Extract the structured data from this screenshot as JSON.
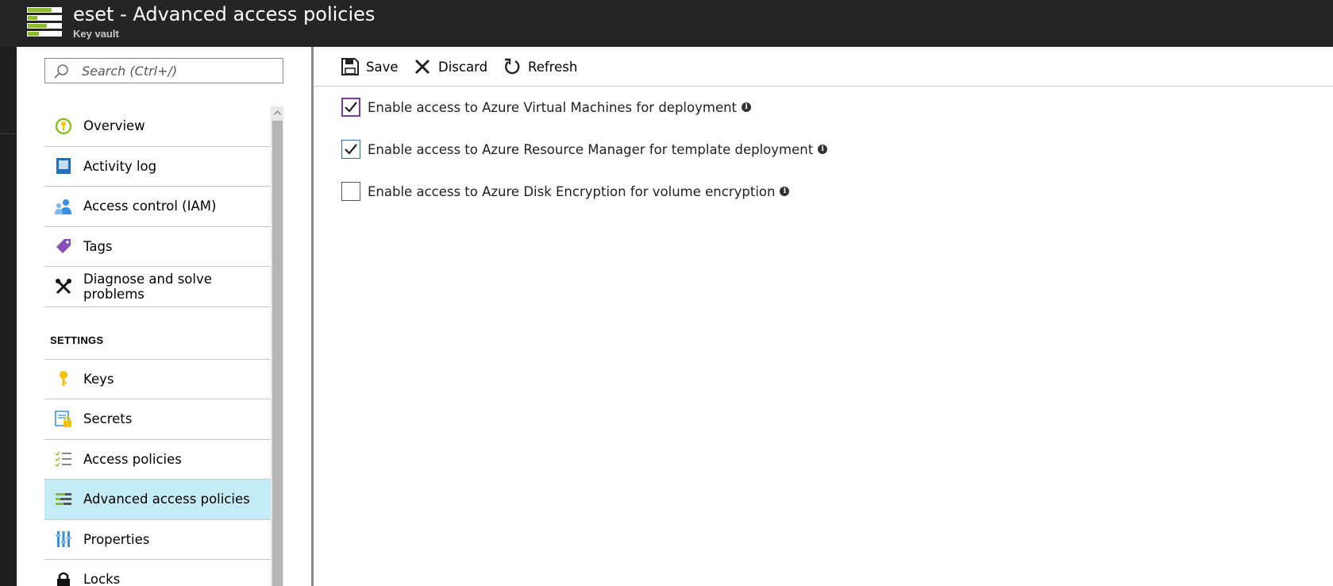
{
  "header": {
    "title": "eset - Advanced access policies",
    "subtitle": "Key vault",
    "icon": "key-vault-policies-icon"
  },
  "search": {
    "placeholder": "Search (Ctrl+/)",
    "value": ""
  },
  "sidebar": {
    "items": [
      {
        "label": "Overview",
        "icon": "overview-icon"
      },
      {
        "label": "Activity log",
        "icon": "activity-log-icon"
      },
      {
        "label": "Access control (IAM)",
        "icon": "iam-icon"
      },
      {
        "label": "Tags",
        "icon": "tag-icon"
      },
      {
        "label": "Diagnose and solve problems",
        "icon": "wrench-icon"
      }
    ],
    "section_label": "SETTINGS",
    "settings_items": [
      {
        "label": "Keys",
        "icon": "key-icon"
      },
      {
        "label": "Secrets",
        "icon": "secrets-icon"
      },
      {
        "label": "Access policies",
        "icon": "access-policies-icon"
      },
      {
        "label": "Advanced access policies",
        "icon": "advanced-policies-icon",
        "active": true
      },
      {
        "label": "Properties",
        "icon": "properties-icon"
      },
      {
        "label": "Locks",
        "icon": "lock-icon"
      }
    ]
  },
  "toolbar": {
    "save_label": "Save",
    "discard_label": "Discard",
    "refresh_label": "Refresh"
  },
  "options": [
    {
      "label": "Enable access to Azure Virtual Machines for deployment",
      "checked": true
    },
    {
      "label": "Enable access to Azure Resource Manager for template deployment",
      "checked": true
    },
    {
      "label": "Enable access to Azure Disk Encryption for volume encryption",
      "checked": false
    }
  ],
  "colors": {
    "header_bg": "#252525",
    "active_item_bg": "#c4ecf7",
    "accent_green": "#8cbf26",
    "focus_purple": "#7a3aa0"
  }
}
